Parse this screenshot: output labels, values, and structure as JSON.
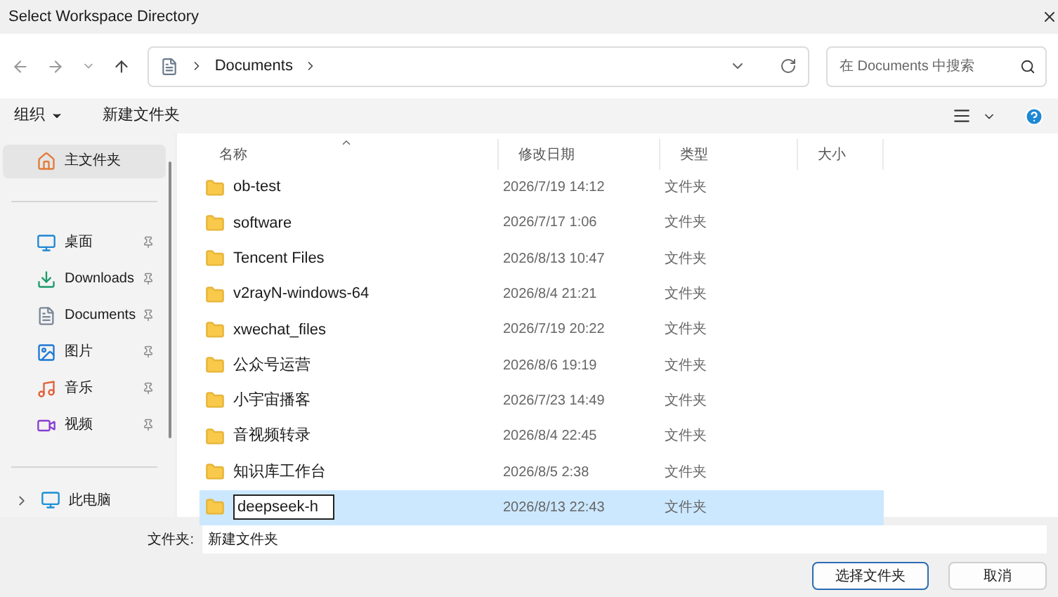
{
  "window": {
    "title": "Select Workspace Directory"
  },
  "address_bar": {
    "path": [
      "Documents"
    ]
  },
  "search": {
    "placeholder": "在 Documents 中搜索"
  },
  "toolbar": {
    "organize": "组织",
    "new_folder": "新建文件夹"
  },
  "sidebar": {
    "home": {
      "label": "主文件夹",
      "kind": "home",
      "selected": true
    },
    "quick_access": [
      {
        "label": "桌面",
        "kind": "desktop",
        "selected": false
      },
      {
        "label": "Downloads",
        "kind": "downloads",
        "selected": false
      },
      {
        "label": "Documents",
        "kind": "documents",
        "selected": false
      },
      {
        "label": "图片",
        "kind": "pictures",
        "selected": false
      },
      {
        "label": "音乐",
        "kind": "music",
        "selected": false
      },
      {
        "label": "视频",
        "kind": "videos",
        "selected": false
      }
    ],
    "this_pc": {
      "label": "此电脑",
      "kind": "pc",
      "selected": false
    }
  },
  "table": {
    "columns": [
      "名称",
      "修改日期",
      "类型",
      "大小"
    ],
    "rows": [
      {
        "name": "ob-test",
        "date": "2026/7/19 14:12",
        "type": "文件夹",
        "selected": false,
        "editing": false
      },
      {
        "name": "software",
        "date": "2026/7/17 1:06",
        "type": "文件夹",
        "selected": false,
        "editing": false
      },
      {
        "name": "Tencent Files",
        "date": "2026/8/13 10:47",
        "type": "文件夹",
        "selected": false,
        "editing": false
      },
      {
        "name": "v2rayN-windows-64",
        "date": "2026/8/4 21:21",
        "type": "文件夹",
        "selected": false,
        "editing": false
      },
      {
        "name": "xwechat_files",
        "date": "2026/7/19 20:22",
        "type": "文件夹",
        "selected": false,
        "editing": false
      },
      {
        "name": "公众号运营",
        "date": "2026/8/6 19:19",
        "type": "文件夹",
        "selected": false,
        "editing": false
      },
      {
        "name": "小宇宙播客",
        "date": "2026/7/23 14:49",
        "type": "文件夹",
        "selected": false,
        "editing": false
      },
      {
        "name": "音视频转录",
        "date": "2026/8/4 22:45",
        "type": "文件夹",
        "selected": false,
        "editing": false
      },
      {
        "name": "知识库工作台",
        "date": "2026/8/5 2:38",
        "type": "文件夹",
        "selected": false,
        "editing": false
      },
      {
        "name": "deepseek-h",
        "date": "2026/8/13 22:43",
        "type": "文件夹",
        "selected": true,
        "editing": true
      }
    ]
  },
  "folder_field": {
    "label": "文件夹:",
    "value": "新建文件夹"
  },
  "buttons": [
    {
      "label": "选择文件夹",
      "kind": "primary"
    },
    {
      "label": "取消",
      "kind": "secondary"
    }
  ]
}
